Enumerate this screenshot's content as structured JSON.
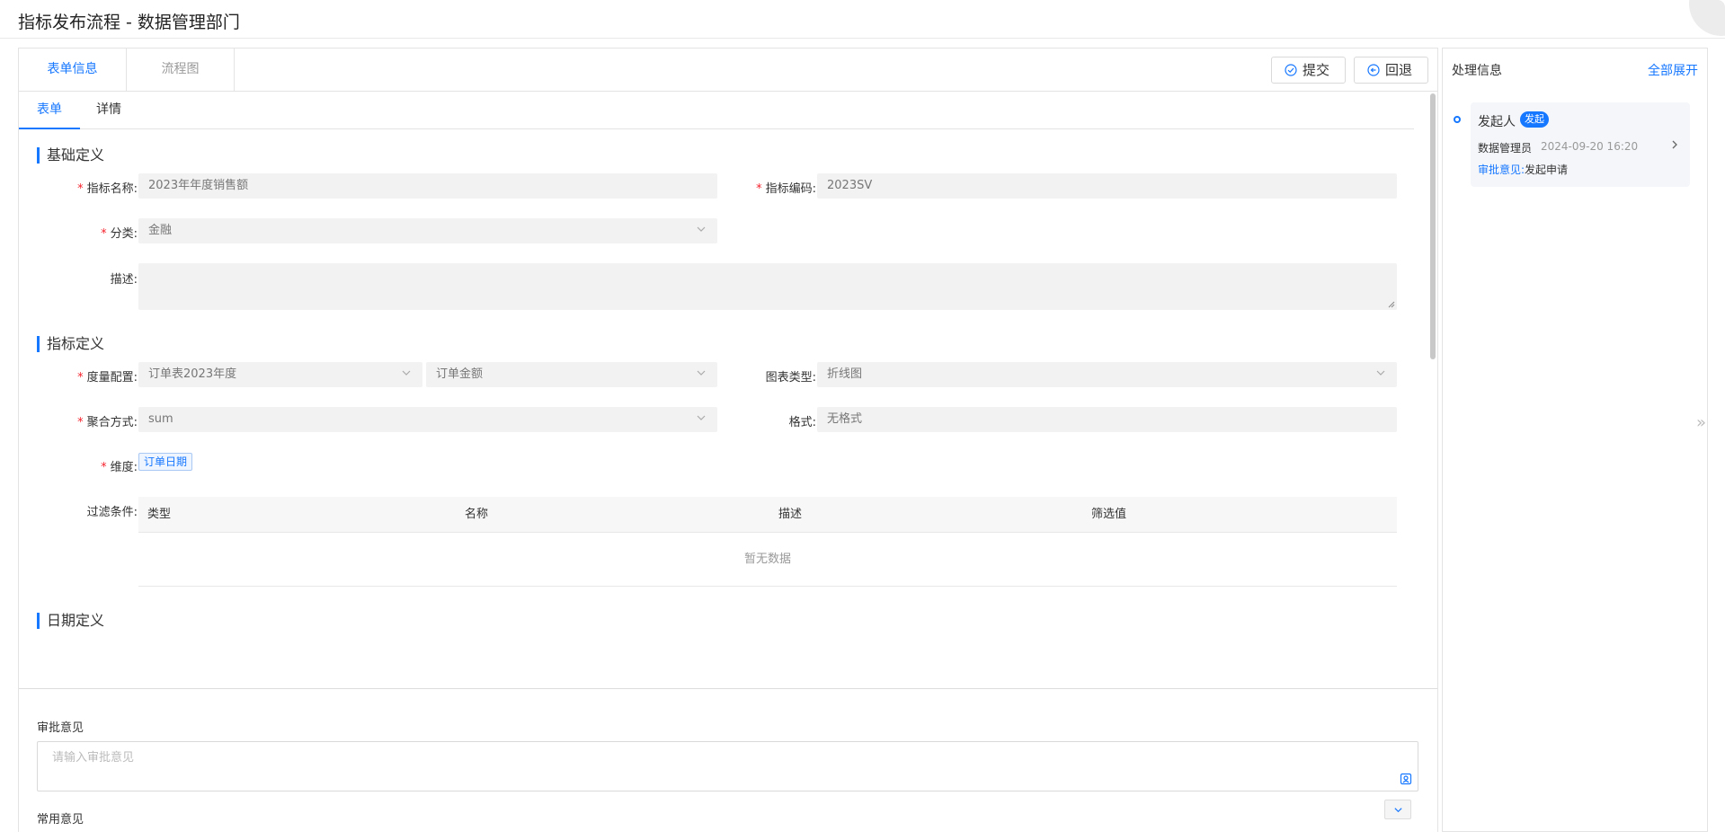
{
  "title": "指标发布流程 - 数据管理部门",
  "top_tabs": [
    "表单信息",
    "流程图"
  ],
  "actions": {
    "submit": "提交",
    "rollback": "回退"
  },
  "sub_tabs": [
    "表单",
    "详情"
  ],
  "sections": {
    "basic": "基础定义",
    "metric": "指标定义",
    "date": "日期定义"
  },
  "basic": {
    "name_label": "指标名称:",
    "name_value": "2023年年度销售额",
    "code_label": "指标编码:",
    "code_value": "2023SV",
    "category_label": "分类:",
    "category_value": "金融",
    "desc_label": "描述:"
  },
  "metric": {
    "measure_label": "度量配置:",
    "measure_table": "订单表2023年度",
    "measure_field": "订单金额",
    "chart_type_label": "图表类型:",
    "chart_type_value": "折线图",
    "agg_label": "聚合方式:",
    "agg_value": "sum",
    "format_label": "格式:",
    "format_value": "无格式",
    "dimension_label": "维度:",
    "dimension_tag": "订单日期",
    "filter_label": "过滤条件:",
    "filter_columns": [
      "类型",
      "名称",
      "描述",
      "筛选值"
    ],
    "filter_empty": "暂无数据"
  },
  "approval": {
    "label": "审批意见",
    "placeholder": "请输入审批意见",
    "common_label": "常用意见"
  },
  "process": {
    "title": "处理信息",
    "expand_all": "全部展开",
    "initiator": "发起人",
    "badge": "发起",
    "user": "数据管理员",
    "time": "2024-09-20 16:20",
    "opinion_key": "审批意见:",
    "opinion_value": "发起申请"
  },
  "colors": {
    "accent": "#1677ff",
    "required": "#f5222d"
  }
}
